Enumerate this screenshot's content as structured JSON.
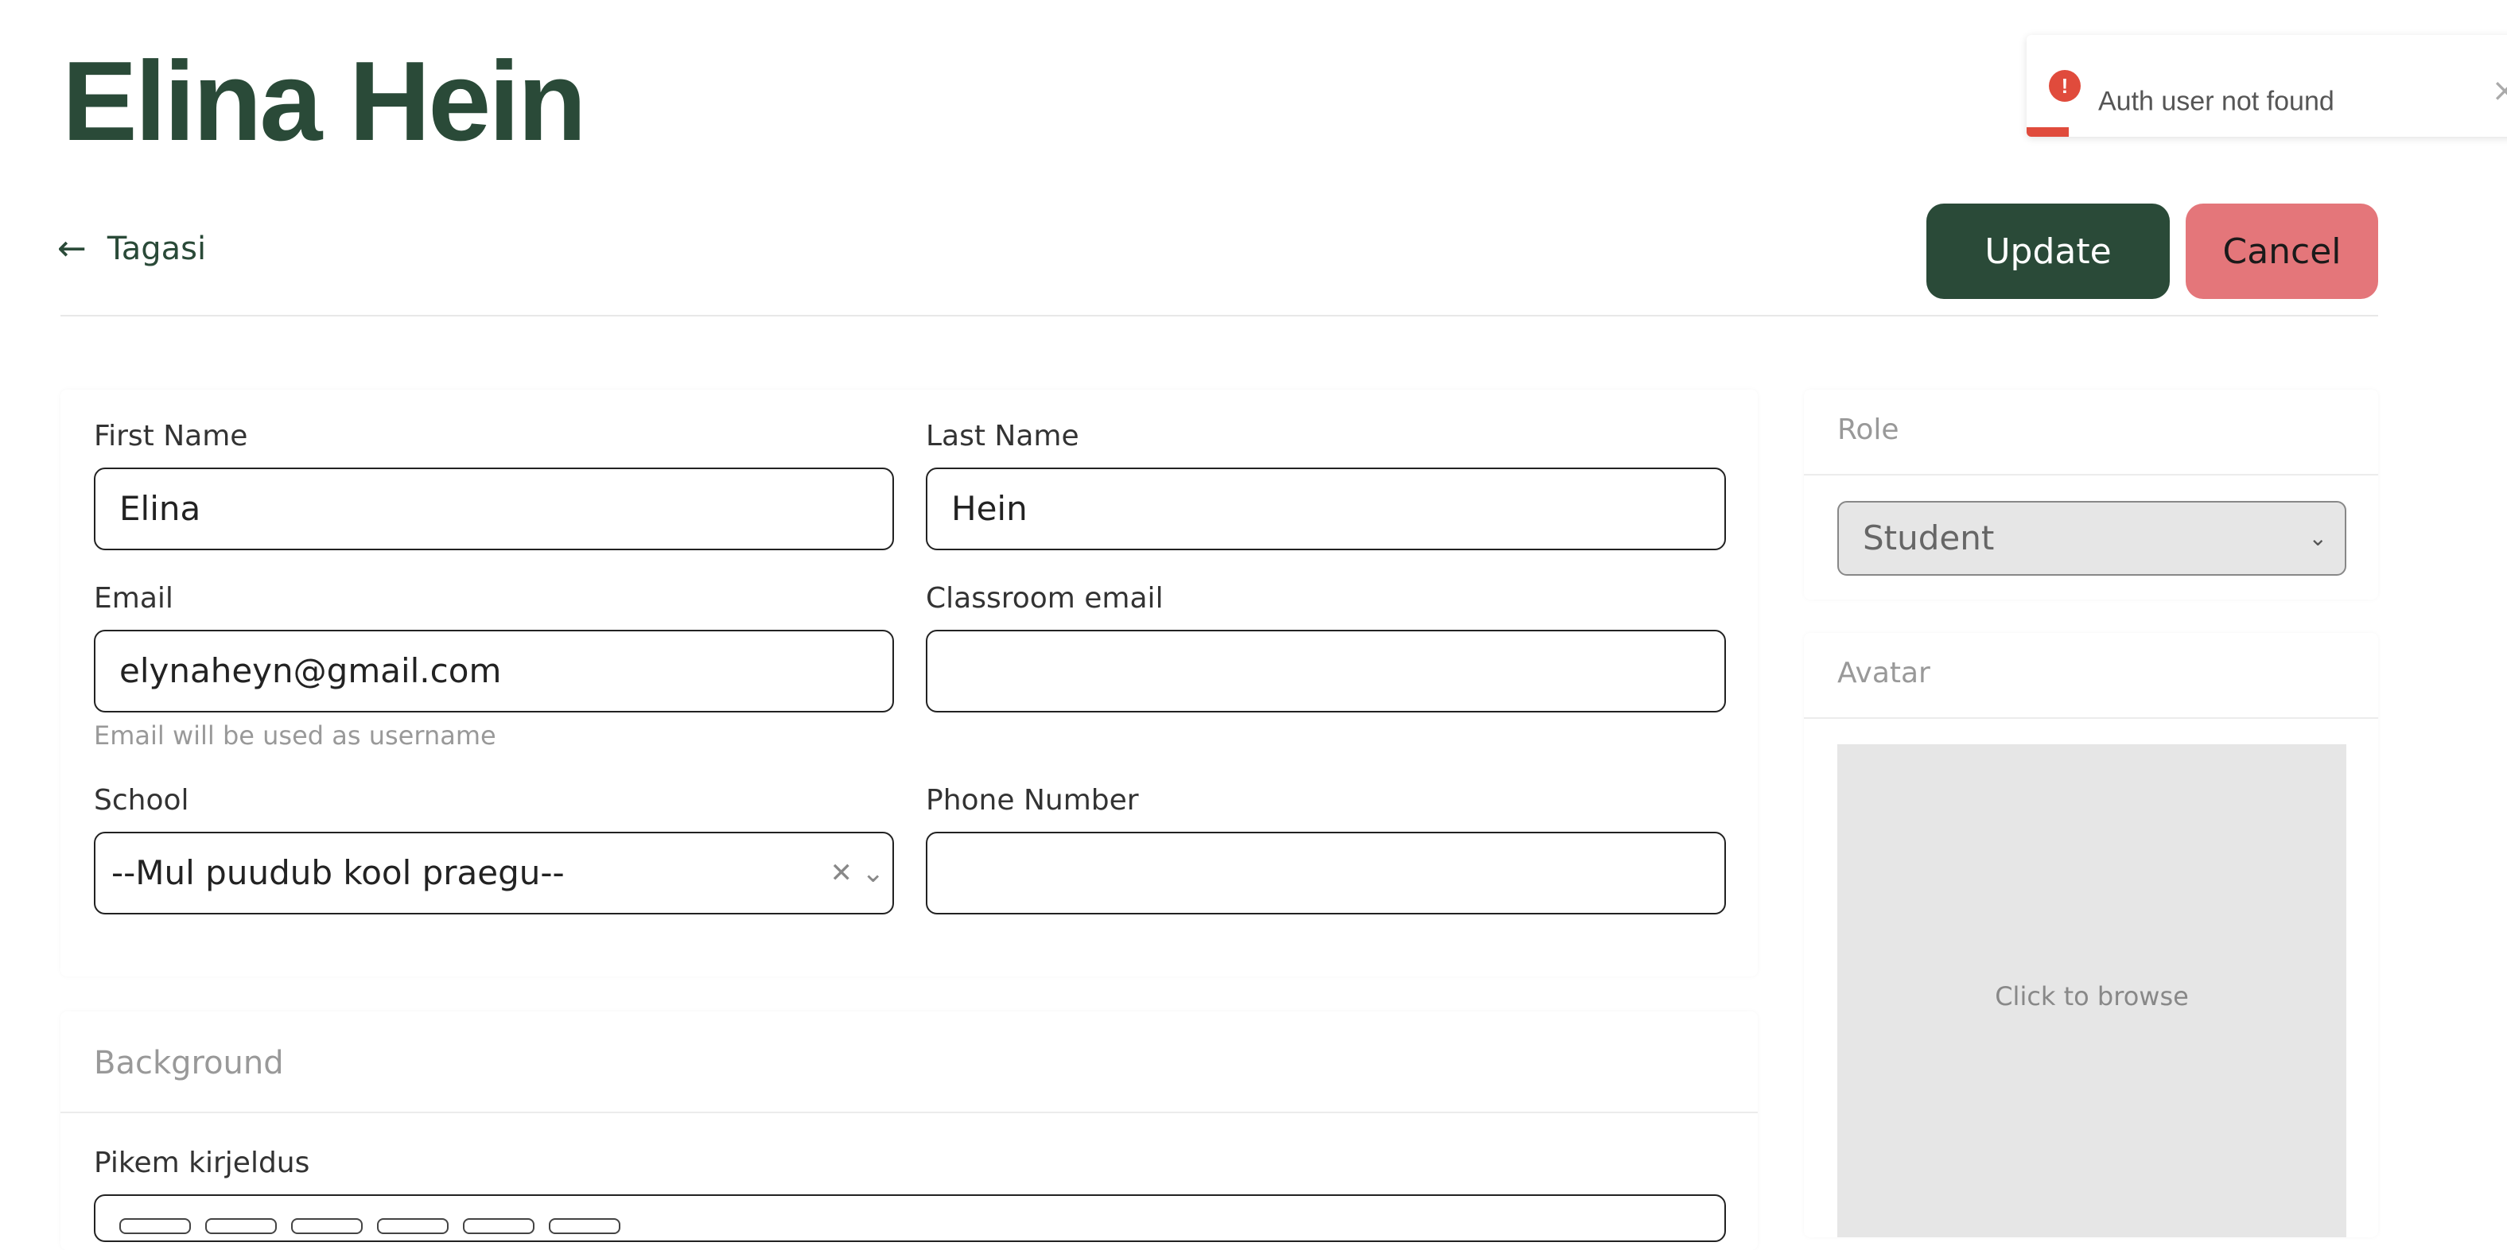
{
  "page": {
    "title": "Elina Hein"
  },
  "toast": {
    "message": "Auth user not found",
    "icon": "alert-circle-icon",
    "close_icon": "close-icon",
    "accent_color": "#e04b3c",
    "progress": 0.085
  },
  "nav": {
    "back_label": "Tagasi",
    "back_icon": "arrow-left-icon"
  },
  "actions": {
    "update_label": "Update",
    "cancel_label": "Cancel",
    "update_color": "#2a4a38",
    "cancel_color": "#e4767a"
  },
  "form": {
    "first_name": {
      "label": "First Name",
      "value": "Elina"
    },
    "last_name": {
      "label": "Last Name",
      "value": "Hein"
    },
    "email": {
      "label": "Email",
      "value": "elynaheyn@gmail.com",
      "hint": "Email will be used as username"
    },
    "classroom_email": {
      "label": "Classroom email",
      "value": ""
    },
    "school": {
      "label": "School",
      "value": "--Mul puudub kool praegu--",
      "clear_icon": "clear-x-icon",
      "chevron_icon": "chevron-down-icon"
    },
    "phone": {
      "label": "Phone Number",
      "value": ""
    }
  },
  "background": {
    "title": "Background",
    "long_description_label": "Pikem kirjeldus"
  },
  "role": {
    "title": "Role",
    "selected": "Student"
  },
  "avatar": {
    "title": "Avatar",
    "browse_text": "Click to browse"
  }
}
